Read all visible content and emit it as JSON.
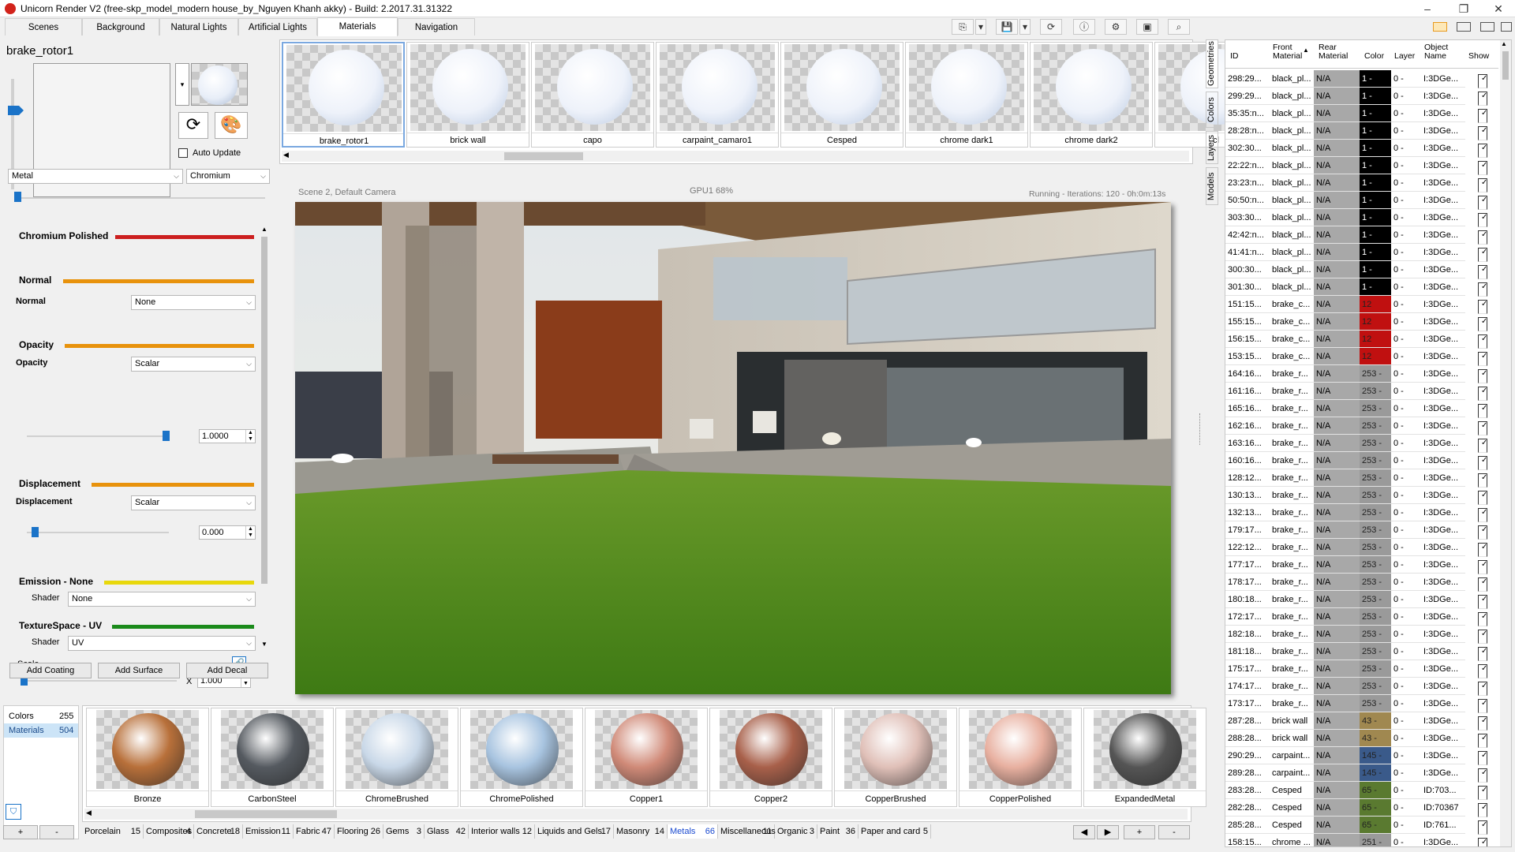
{
  "window": {
    "title": "Unicorn Render V2 (free-skp_model_modern house_by_Nguyen Khanh akky) - Build: 2.2017.31.31322",
    "minimize": "–",
    "restore": "❐",
    "close": "✕"
  },
  "tabs": [
    "Scenes",
    "Background",
    "Natural Lights",
    "Artificial Lights",
    "Materials",
    "Navigation"
  ],
  "material_editor": {
    "name": "brake_rotor1",
    "auto_update_label": "Auto Update",
    "type_select": "Metal",
    "subtype_select": "Chromium",
    "layers": [
      {
        "title": "Chromium Polished",
        "color": "#cc1f1f"
      },
      {
        "title": "Normal",
        "color": "#e8920c"
      },
      {
        "title": "Opacity",
        "color": "#e8920c"
      },
      {
        "title": "Displacement",
        "color": "#e8920c"
      },
      {
        "title": "Emission - None",
        "color": "#e8d80c"
      },
      {
        "title": "TextureSpace - UV",
        "color": "#1a8a1a"
      }
    ],
    "normal_label": "Normal",
    "normal_value": "None",
    "opacity_label": "Opacity",
    "opacity_mode": "Scalar",
    "opacity_value": "1.0000",
    "opacity_level": 1.0,
    "displacement_label": "Displacement",
    "displacement_mode": "Scalar",
    "displacement_value": "0.000",
    "emission_shader_label": "Shader",
    "emission_shader": "None",
    "uv_shader_label": "Shader",
    "uv_shader": "UV",
    "scale_label": "Scale",
    "scale_x_label": "X",
    "scale_value": "1.000",
    "buttons": [
      "Add Coating",
      "Add Surface",
      "Add Decal"
    ]
  },
  "material_strip": {
    "items": [
      "brake_rotor1",
      "brick wall",
      "capo",
      "carpaint_camaro1",
      "Cesped",
      "chrome dark1",
      "chrome dark2",
      "cl"
    ]
  },
  "viewport": {
    "scene_label": "Scene 2, Default Camera",
    "gpu_label": "GPU1 68%",
    "status": "Running - Iterations: 120 - 0h:0m:13s"
  },
  "library": {
    "counts": [
      {
        "label": "Colors",
        "value": "255"
      },
      {
        "label": "Materials",
        "value": "504"
      }
    ],
    "add_label": "+",
    "remove_label": "-",
    "items": [
      {
        "name": "Bronze",
        "color": "#b8703a"
      },
      {
        "name": "CarbonSteel",
        "color": "#555a60"
      },
      {
        "name": "ChromeBrushed",
        "color": "#c9d8e8"
      },
      {
        "name": "ChromePolished",
        "color": "#a8c4e0"
      },
      {
        "name": "Copper1",
        "color": "#d08a78"
      },
      {
        "name": "Copper2",
        "color": "#a8604a"
      },
      {
        "name": "CopperBrushed",
        "color": "#e0c0b8"
      },
      {
        "name": "CopperPolished",
        "color": "#e8b0a0"
      },
      {
        "name": "ExpandedMetal",
        "color": "#555555"
      }
    ],
    "categories": [
      {
        "name": "Porcelain",
        "count": "15"
      },
      {
        "name": "Composites",
        "count": "4"
      },
      {
        "name": "Concrete",
        "count": "18"
      },
      {
        "name": "Emission",
        "count": "11"
      },
      {
        "name": "Fabric",
        "count": "47"
      },
      {
        "name": "Flooring",
        "count": "26"
      },
      {
        "name": "Gems",
        "count": "3"
      },
      {
        "name": "Glass",
        "count": "42"
      },
      {
        "name": "Interior walls",
        "count": "12"
      },
      {
        "name": "Liquids and Gels",
        "count": "17"
      },
      {
        "name": "Masonry",
        "count": "14"
      },
      {
        "name": "Metals",
        "count": "66"
      },
      {
        "name": "Miscellaneous",
        "count": "11"
      },
      {
        "name": "Organic",
        "count": "3"
      },
      {
        "name": "Paint",
        "count": "36"
      },
      {
        "name": "Paper and card",
        "count": "5"
      }
    ],
    "nav_prev": "◀",
    "nav_next": "▶",
    "nav_add": "+",
    "nav_remove": "-"
  },
  "side_tabs": [
    "Geometries",
    "Colors",
    "Layers",
    "Models"
  ],
  "geometry_table": {
    "columns": [
      "ID",
      "Front Material",
      "Rear Material",
      "Color",
      "Layer",
      "Object Name",
      "Show"
    ],
    "rows": [
      {
        "id": "298:29...",
        "front": "black_pl...",
        "rear": "N/A",
        "color": "1 -",
        "sw": "#000000",
        "layer": "0 -",
        "obj": "I:3DGe..."
      },
      {
        "id": "299:29...",
        "front": "black_pl...",
        "rear": "N/A",
        "color": "1 -",
        "sw": "#000000",
        "layer": "0 -",
        "obj": "I:3DGe..."
      },
      {
        "id": "35:35:n...",
        "front": "black_pl...",
        "rear": "N/A",
        "color": "1 -",
        "sw": "#000000",
        "layer": "0 -",
        "obj": "I:3DGe..."
      },
      {
        "id": "28:28:n...",
        "front": "black_pl...",
        "rear": "N/A",
        "color": "1 -",
        "sw": "#000000",
        "layer": "0 -",
        "obj": "I:3DGe..."
      },
      {
        "id": "302:30...",
        "front": "black_pl...",
        "rear": "N/A",
        "color": "1 -",
        "sw": "#000000",
        "layer": "0 -",
        "obj": "I:3DGe..."
      },
      {
        "id": "22:22:n...",
        "front": "black_pl...",
        "rear": "N/A",
        "color": "1 -",
        "sw": "#000000",
        "layer": "0 -",
        "obj": "I:3DGe..."
      },
      {
        "id": "23:23:n...",
        "front": "black_pl...",
        "rear": "N/A",
        "color": "1 -",
        "sw": "#000000",
        "layer": "0 -",
        "obj": "I:3DGe..."
      },
      {
        "id": "50:50:n...",
        "front": "black_pl...",
        "rear": "N/A",
        "color": "1 -",
        "sw": "#000000",
        "layer": "0 -",
        "obj": "I:3DGe..."
      },
      {
        "id": "303:30...",
        "front": "black_pl...",
        "rear": "N/A",
        "color": "1 -",
        "sw": "#000000",
        "layer": "0 -",
        "obj": "I:3DGe..."
      },
      {
        "id": "42:42:n...",
        "front": "black_pl...",
        "rear": "N/A",
        "color": "1 -",
        "sw": "#000000",
        "layer": "0 -",
        "obj": "I:3DGe..."
      },
      {
        "id": "41:41:n...",
        "front": "black_pl...",
        "rear": "N/A",
        "color": "1 -",
        "sw": "#000000",
        "layer": "0 -",
        "obj": "I:3DGe..."
      },
      {
        "id": "300:30...",
        "front": "black_pl...",
        "rear": "N/A",
        "color": "1 -",
        "sw": "#000000",
        "layer": "0 -",
        "obj": "I:3DGe..."
      },
      {
        "id": "301:30...",
        "front": "black_pl...",
        "rear": "N/A",
        "color": "1 -",
        "sw": "#000000",
        "layer": "0 -",
        "obj": "I:3DGe..."
      },
      {
        "id": "151:15...",
        "front": "brake_c...",
        "rear": "N/A",
        "color": "12",
        "sw": "#c01010",
        "layer": "0 -",
        "obj": "I:3DGe..."
      },
      {
        "id": "155:15...",
        "front": "brake_c...",
        "rear": "N/A",
        "color": "12",
        "sw": "#c01010",
        "layer": "0 -",
        "obj": "I:3DGe..."
      },
      {
        "id": "156:15...",
        "front": "brake_c...",
        "rear": "N/A",
        "color": "12",
        "sw": "#c01010",
        "layer": "0 -",
        "obj": "I:3DGe..."
      },
      {
        "id": "153:15...",
        "front": "brake_c...",
        "rear": "N/A",
        "color": "12",
        "sw": "#c01010",
        "layer": "0 -",
        "obj": "I:3DGe..."
      },
      {
        "id": "164:16...",
        "front": "brake_r...",
        "rear": "N/A",
        "color": "253 -",
        "sw": "#9a9a9a",
        "layer": "0 -",
        "obj": "I:3DGe..."
      },
      {
        "id": "161:16...",
        "front": "brake_r...",
        "rear": "N/A",
        "color": "253 -",
        "sw": "#9a9a9a",
        "layer": "0 -",
        "obj": "I:3DGe..."
      },
      {
        "id": "165:16...",
        "front": "brake_r...",
        "rear": "N/A",
        "color": "253 -",
        "sw": "#9a9a9a",
        "layer": "0 -",
        "obj": "I:3DGe..."
      },
      {
        "id": "162:16...",
        "front": "brake_r...",
        "rear": "N/A",
        "color": "253 -",
        "sw": "#9a9a9a",
        "layer": "0 -",
        "obj": "I:3DGe..."
      },
      {
        "id": "163:16...",
        "front": "brake_r...",
        "rear": "N/A",
        "color": "253 -",
        "sw": "#9a9a9a",
        "layer": "0 -",
        "obj": "I:3DGe..."
      },
      {
        "id": "160:16...",
        "front": "brake_r...",
        "rear": "N/A",
        "color": "253 -",
        "sw": "#9a9a9a",
        "layer": "0 -",
        "obj": "I:3DGe..."
      },
      {
        "id": "128:12...",
        "front": "brake_r...",
        "rear": "N/A",
        "color": "253 -",
        "sw": "#9a9a9a",
        "layer": "0 -",
        "obj": "I:3DGe..."
      },
      {
        "id": "130:13...",
        "front": "brake_r...",
        "rear": "N/A",
        "color": "253 -",
        "sw": "#9a9a9a",
        "layer": "0 -",
        "obj": "I:3DGe..."
      },
      {
        "id": "132:13...",
        "front": "brake_r...",
        "rear": "N/A",
        "color": "253 -",
        "sw": "#9a9a9a",
        "layer": "0 -",
        "obj": "I:3DGe..."
      },
      {
        "id": "179:17...",
        "front": "brake_r...",
        "rear": "N/A",
        "color": "253 -",
        "sw": "#9a9a9a",
        "layer": "0 -",
        "obj": "I:3DGe..."
      },
      {
        "id": "122:12...",
        "front": "brake_r...",
        "rear": "N/A",
        "color": "253 -",
        "sw": "#9a9a9a",
        "layer": "0 -",
        "obj": "I:3DGe..."
      },
      {
        "id": "177:17...",
        "front": "brake_r...",
        "rear": "N/A",
        "color": "253 -",
        "sw": "#9a9a9a",
        "layer": "0 -",
        "obj": "I:3DGe..."
      },
      {
        "id": "178:17...",
        "front": "brake_r...",
        "rear": "N/A",
        "color": "253 -",
        "sw": "#9a9a9a",
        "layer": "0 -",
        "obj": "I:3DGe..."
      },
      {
        "id": "180:18...",
        "front": "brake_r...",
        "rear": "N/A",
        "color": "253 -",
        "sw": "#9a9a9a",
        "layer": "0 -",
        "obj": "I:3DGe..."
      },
      {
        "id": "172:17...",
        "front": "brake_r...",
        "rear": "N/A",
        "color": "253 -",
        "sw": "#9a9a9a",
        "layer": "0 -",
        "obj": "I:3DGe..."
      },
      {
        "id": "182:18...",
        "front": "brake_r...",
        "rear": "N/A",
        "color": "253 -",
        "sw": "#9a9a9a",
        "layer": "0 -",
        "obj": "I:3DGe..."
      },
      {
        "id": "181:18...",
        "front": "brake_r...",
        "rear": "N/A",
        "color": "253 -",
        "sw": "#9a9a9a",
        "layer": "0 -",
        "obj": "I:3DGe..."
      },
      {
        "id": "175:17...",
        "front": "brake_r...",
        "rear": "N/A",
        "color": "253 -",
        "sw": "#9a9a9a",
        "layer": "0 -",
        "obj": "I:3DGe..."
      },
      {
        "id": "174:17...",
        "front": "brake_r...",
        "rear": "N/A",
        "color": "253 -",
        "sw": "#9a9a9a",
        "layer": "0 -",
        "obj": "I:3DGe..."
      },
      {
        "id": "173:17...",
        "front": "brake_r...",
        "rear": "N/A",
        "color": "253 -",
        "sw": "#9a9a9a",
        "layer": "0 -",
        "obj": "I:3DGe..."
      },
      {
        "id": "287:28...",
        "front": "brick wall",
        "rear": "N/A",
        "color": "43 -",
        "sw": "#a08850",
        "layer": "0 -",
        "obj": "I:3DGe..."
      },
      {
        "id": "288:28...",
        "front": "brick wall",
        "rear": "N/A",
        "color": "43 -",
        "sw": "#a08850",
        "layer": "0 -",
        "obj": "I:3DGe..."
      },
      {
        "id": "290:29...",
        "front": "carpaint...",
        "rear": "N/A",
        "color": "145 -",
        "sw": "#3a5a8a",
        "layer": "0 -",
        "obj": "I:3DGe..."
      },
      {
        "id": "289:28...",
        "front": "carpaint...",
        "rear": "N/A",
        "color": "145 -",
        "sw": "#3a5a8a",
        "layer": "0 -",
        "obj": "I:3DGe..."
      },
      {
        "id": "283:28...",
        "front": "Cesped",
        "rear": "N/A",
        "color": "65 -",
        "sw": "#5a7a30",
        "layer": "0 -",
        "obj": "ID:703..."
      },
      {
        "id": "282:28...",
        "front": "Cesped",
        "rear": "N/A",
        "color": "65 -",
        "sw": "#5a7a30",
        "layer": "0 -",
        "obj": "ID:70367"
      },
      {
        "id": "285:28...",
        "front": "Cesped",
        "rear": "N/A",
        "color": "65 -",
        "sw": "#5a7a30",
        "layer": "0 -",
        "obj": "ID:761..."
      },
      {
        "id": "158:15...",
        "front": "chrome ...",
        "rear": "N/A",
        "color": "251 -",
        "sw": "#9a9a9a",
        "layer": "0 -",
        "obj": "I:3DGe..."
      }
    ]
  }
}
